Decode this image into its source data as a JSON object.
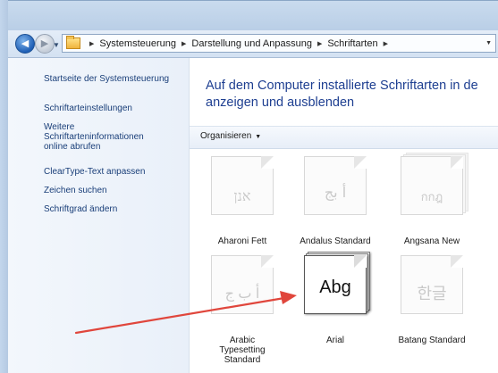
{
  "address": {
    "crumbs": [
      "Systemsteuerung",
      "Darstellung und Anpassung",
      "Schriftarten"
    ]
  },
  "sidebar": {
    "items": [
      {
        "label": "Startseite der Systemsteuerung"
      },
      {
        "label": "Schriftarteinstellungen"
      },
      {
        "label_lines": [
          "Weitere",
          "Schriftarteninformationen",
          "online abrufen"
        ]
      },
      {
        "label": "ClearType-Text anpassen"
      },
      {
        "label": "Zeichen suchen"
      },
      {
        "label": "Schriftgrad ändern"
      }
    ]
  },
  "main": {
    "title": "Auf dem Computer installierte Schriftarten in de anzeigen und ausblenden",
    "toolbar": {
      "organize_label": "Organisieren"
    },
    "fonts": [
      {
        "name": "Aharoni Fett",
        "sample": "אנן",
        "stacked": false,
        "selected": false
      },
      {
        "name": "Andalus Standard",
        "sample": "أ بج",
        "stacked": false,
        "selected": false
      },
      {
        "name": "Angsana New",
        "sample": "กกฎ",
        "stacked": true,
        "selected": false
      },
      {
        "name_lines": [
          "Arabic",
          "Typesetting",
          "Standard"
        ],
        "sample": "ﺃ ﺏ ﺝ",
        "stacked": false,
        "selected": false
      },
      {
        "name": "Arial",
        "sample": "Abg",
        "stacked": true,
        "selected": true
      },
      {
        "name": "Batang Standard",
        "sample": "한글",
        "stacked": false,
        "selected": false
      }
    ]
  },
  "colors": {
    "link": "#1a3f79",
    "heading": "#1e3f91",
    "annotation_arrow": "#e0463c"
  }
}
